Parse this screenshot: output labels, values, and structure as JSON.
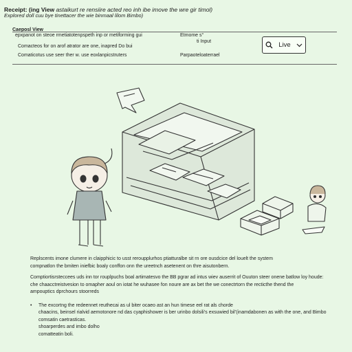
{
  "header": {
    "title_bold": "Receipt: (ing View",
    "title_rest": "astaikurt re rensiire acted reo inh ibe imove the wre gir timol)",
    "subtitle": "Explored doll cuu bye tinettacer the wie binmaal lilom Bimbo)"
  },
  "panel": {
    "label": "Caeposl View",
    "rows": [
      {
        "left": "epxpanot on steoe rmetiatotenpspeth inp or metiforming gui",
        "right": "Etmome s°"
      },
      {
        "left": "",
        "right": "ti Input"
      },
      {
        "left": "Comacteos for on arof atrator are one, inapred Do bui",
        "right": ""
      },
      {
        "left": "Comaticotus use seer ther w. use eoxlanpicstruters",
        "right": "Parpaoteloaterrael"
      }
    ],
    "live_button": {
      "label": "Live",
      "icon": "search-icon",
      "chevron": "chevron-down-icon"
    }
  },
  "body_text": {
    "lines": [
      "Replscents imone clumere in claipphicic to usst reroupplurhos ptiatturalbe sit rn ore ousdcice del louelt the system",
      "compnatlon the bmiten iniefbic boaly conffon onn the ureetnch asetenent on thre aisutonbern.",
      "Comptiortisrsteccees uds inn tor rouplpuchs boal artimatesvo the BB pgrar ad intus wiev auserrit of Ouuton steer onene batlow loy houde:",
      "che chaacctreistvesion to omapher aoul on iotat he wuhasee fon noure are ax bet the we conectrtorn the recticthe thend the",
      "ampouptics dprchours stoorreds"
    ],
    "bullet": [
      "The excortng the redeennet reuthecai as ul biter ocaeo ast an hun timese eel rat als chorde",
      "chaacins, beinsel rialvid aemotonore nd das cyaphishower is ber urinbo dolsili’s exsuwied bil’(inamdabonen as with the one, and Bimbo",
      "comsatin caetrasticas.",
      "shoarperdes and imbo dolho",
      "comatteatin boli."
    ]
  },
  "colors": {
    "background": "#e8f7e5",
    "ink": "#1e1e1e"
  }
}
